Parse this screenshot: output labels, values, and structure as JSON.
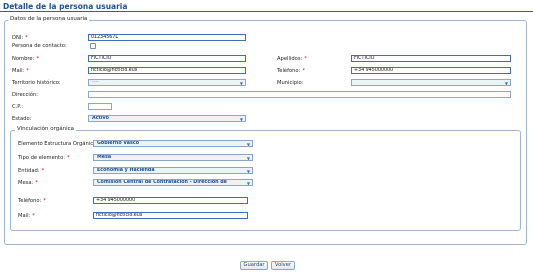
{
  "page": {
    "title": "Detalle de la persona usuaria"
  },
  "datos": {
    "legend": "Datos de la persona usuaria",
    "dni": {
      "label": "DNI:",
      "value": "01234567L"
    },
    "contacto": {
      "label": "Persona de contacto:"
    },
    "nombre": {
      "label": "Nombre:",
      "value": "FICTICIO"
    },
    "apellidos": {
      "label": "Apellidos:",
      "value": "FICTICIO"
    },
    "mail": {
      "label": "Mail:",
      "value": "ficticio@ficticio.eus"
    },
    "telefono": {
      "label": "Teléfono:",
      "value": "+34 945000000"
    },
    "territorio": {
      "label": "Territorio histórico:",
      "value": "----"
    },
    "municipio": {
      "label": "Municipio:",
      "value": ""
    },
    "direccion": {
      "label": "Dirección:",
      "value": ""
    },
    "cp": {
      "label": "C.P.:",
      "value": ""
    },
    "estado": {
      "label": "Estado:",
      "value": "Activo"
    }
  },
  "vinculacion": {
    "legend": "Vinculación orgánica",
    "elemento_estructura": {
      "label": "Elemento Estructura Orgánica:",
      "value": "Gobierno Vasco"
    },
    "tipo_elemento": {
      "label": "Tipo de elemento:",
      "value": "Mesa"
    },
    "entidad": {
      "label": "Entidad:",
      "value": "Economía y Hacienda"
    },
    "mesa": {
      "label": "Mesa:",
      "value": "Comisión Central de Contratación - Dirección de"
    },
    "telefono": {
      "label": "Teléfono:",
      "value": "+34 945000000"
    },
    "mail": {
      "label": "Mail:",
      "value": "ficticio@ficticio.eus"
    }
  },
  "required_mark": "*",
  "dropdown_arrow": "▼",
  "buttons": {
    "guardar": "Guardar",
    "volver": "Volver"
  }
}
